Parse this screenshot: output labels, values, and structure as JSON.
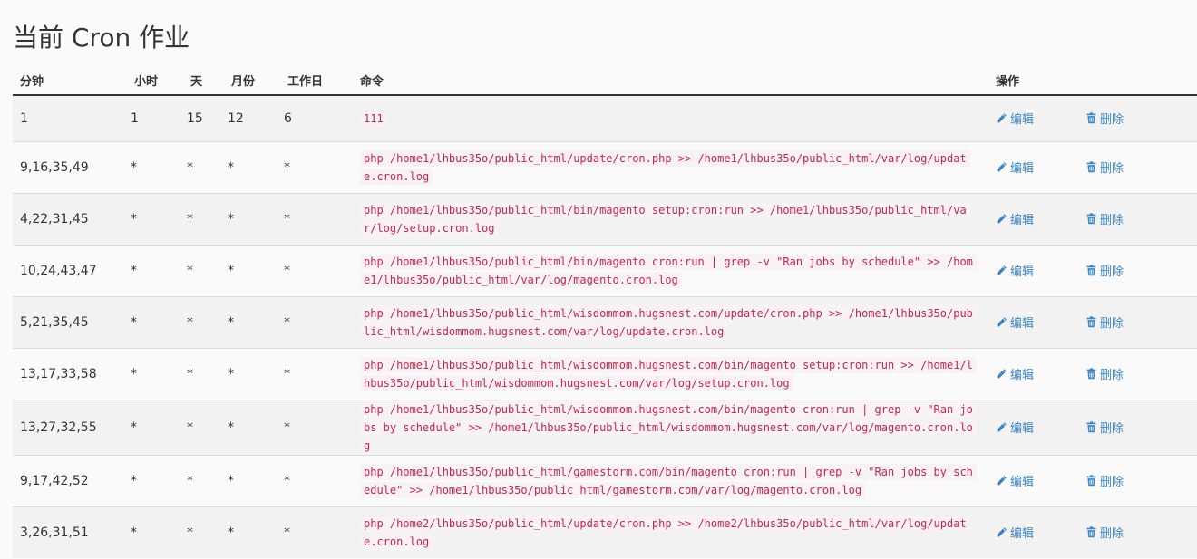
{
  "page": {
    "title": "当前 Cron 作业"
  },
  "table": {
    "headers": [
      "分钟",
      "小时",
      "天",
      "月份",
      "工作日",
      "命令",
      "操作"
    ],
    "edit_label": "编辑",
    "delete_label": "删除",
    "rows": [
      {
        "minute": "1",
        "hour": "1",
        "day": "15",
        "month": "12",
        "weekday": "6",
        "command": "111"
      },
      {
        "minute": "9,16,35,49",
        "hour": "*",
        "day": "*",
        "month": "*",
        "weekday": "*",
        "command": "php /home1/lhbus35o/public_html/update/cron.php >> /home1/lhbus35o/public_html/var/log/update.cron.log"
      },
      {
        "minute": "4,22,31,45",
        "hour": "*",
        "day": "*",
        "month": "*",
        "weekday": "*",
        "command": "php /home1/lhbus35o/public_html/bin/magento setup:cron:run >> /home1/lhbus35o/public_html/var/log/setup.cron.log"
      },
      {
        "minute": "10,24,43,47",
        "hour": "*",
        "day": "*",
        "month": "*",
        "weekday": "*",
        "command": "php /home1/lhbus35o/public_html/bin/magento cron:run | grep -v \"Ran jobs by schedule\" >> /home1/lhbus35o/public_html/var/log/magento.cron.log"
      },
      {
        "minute": "5,21,35,45",
        "hour": "*",
        "day": "*",
        "month": "*",
        "weekday": "*",
        "command": "php /home1/lhbus35o/public_html/wisdommom.hugsnest.com/update/cron.php >> /home1/lhbus35o/public_html/wisdommom.hugsnest.com/var/log/update.cron.log"
      },
      {
        "minute": "13,17,33,58",
        "hour": "*",
        "day": "*",
        "month": "*",
        "weekday": "*",
        "command": "php /home1/lhbus35o/public_html/wisdommom.hugsnest.com/bin/magento setup:cron:run >> /home1/lhbus35o/public_html/wisdommom.hugsnest.com/var/log/setup.cron.log"
      },
      {
        "minute": "13,27,32,55",
        "hour": "*",
        "day": "*",
        "month": "*",
        "weekday": "*",
        "command": "php /home1/lhbus35o/public_html/wisdommom.hugsnest.com/bin/magento cron:run | grep -v \"Ran jobs by schedule\" >> /home1/lhbus35o/public_html/wisdommom.hugsnest.com/var/log/magento.cron.log"
      },
      {
        "minute": "9,17,42,52",
        "hour": "*",
        "day": "*",
        "month": "*",
        "weekday": "*",
        "command": "php /home1/lhbus35o/public_html/gamestorm.com/bin/magento cron:run | grep -v \"Ran jobs by schedule\" >> /home1/lhbus35o/public_html/gamestorm.com/var/log/magento.cron.log"
      },
      {
        "minute": "3,26,31,51",
        "hour": "*",
        "day": "*",
        "month": "*",
        "weekday": "*",
        "command": "php /home2/lhbus35o/public_html/update/cron.php >> /home2/lhbus35o/public_html/var/log/update.cron.log"
      }
    ]
  },
  "colors": {
    "link": "#3a87c8",
    "code_text": "#c7254e",
    "code_bg": "#f9f2f4"
  },
  "icons": {
    "edit": "pencil-icon",
    "delete": "trash-icon"
  }
}
